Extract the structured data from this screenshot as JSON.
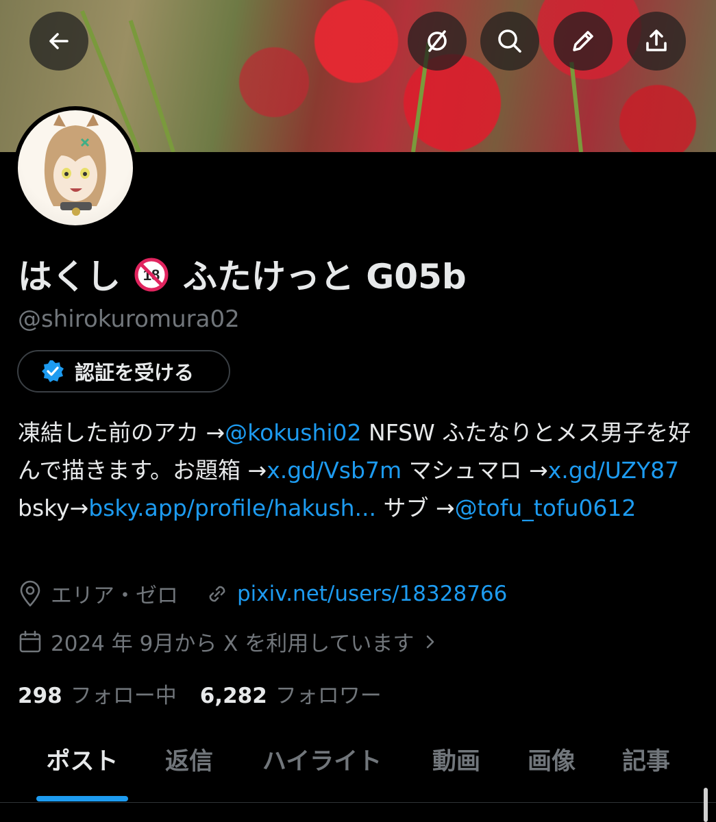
{
  "profile": {
    "name_prefix": "はくし",
    "adult_badge": "18",
    "name_suffix": "ふたけっと G05b",
    "handle": "@shirokuromura02",
    "verify_label": "認証を受ける"
  },
  "bio": {
    "t1": "凍結した前のアカ →",
    "link1": "@kokushi02",
    "t2": " NFSW ふたなりとメス男子を好んで描きます。お題箱 →",
    "link2": "x.gd/Vsb7m",
    "t3": " マシュマロ →",
    "link3": "x.gd/UZY87",
    "t4": " bsky→",
    "link4": "bsky.app/profile/hakush...",
    "t5": " サブ →",
    "link5": "@tofu_tofu0612"
  },
  "meta": {
    "location": "エリア・ゼロ",
    "website": "pixiv.net/users/18328766",
    "joined": "2024 年 9月から X を利用しています"
  },
  "stats": {
    "following_count": "298",
    "following_label": "フォロー中",
    "followers_count": "6,282",
    "followers_label": "フォロワー"
  },
  "tabs": [
    {
      "label": "ポスト"
    },
    {
      "label": "返信"
    },
    {
      "label": "ハイライト"
    },
    {
      "label": "動画"
    },
    {
      "label": "画像"
    },
    {
      "label": "記事"
    }
  ],
  "icons": {
    "back": "back-arrow-icon",
    "grok": "grok-icon",
    "search": "search-icon",
    "edit": "edit-icon",
    "share": "share-icon",
    "verified": "verified-badge-icon",
    "location": "location-pin-icon",
    "link": "link-icon",
    "calendar": "calendar-icon",
    "chevron": "chevron-right-icon"
  },
  "colors": {
    "accent": "#1d9bf0",
    "background": "#000000",
    "text_primary": "#e7e9ea",
    "text_secondary": "#71767b",
    "adult_badge_red": "#e0245e"
  }
}
